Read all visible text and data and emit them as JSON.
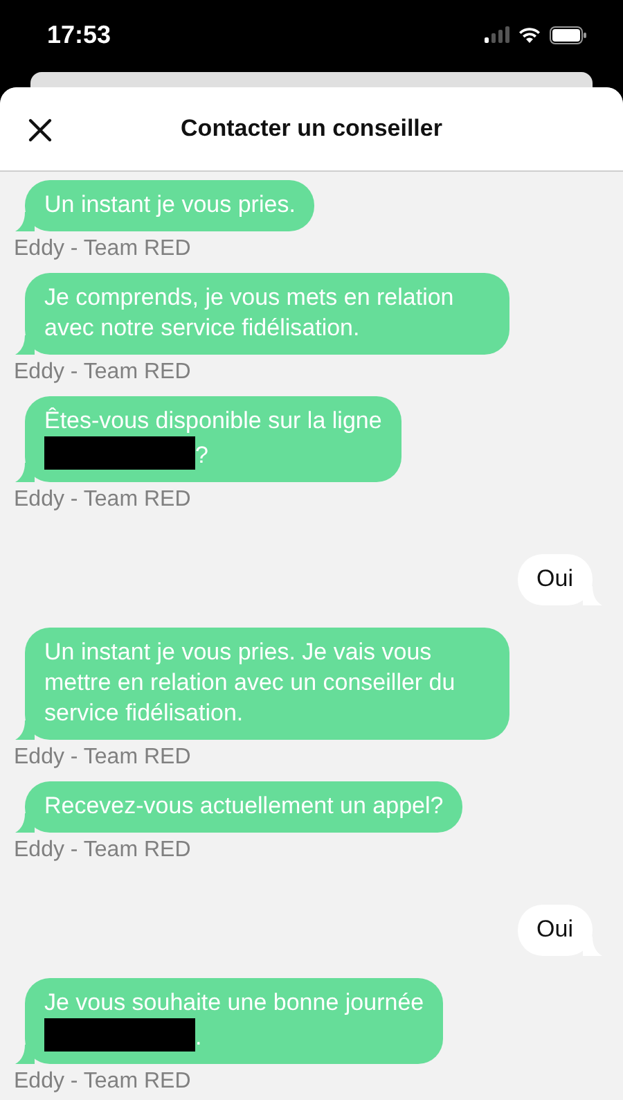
{
  "status_bar": {
    "time": "17:53"
  },
  "header": {
    "title": "Contacter un conseiller"
  },
  "messages": [
    {
      "kind": "agent",
      "text": "Un instant je vous pries.",
      "sender": "Eddy - Team RED"
    },
    {
      "kind": "agent",
      "text": "Je comprends, je vous mets en relation avec notre service fidélisation.",
      "sender": "Eddy - Team RED"
    },
    {
      "kind": "agent",
      "text": "Êtes-vous disponible sur la ligne",
      "redacted": true,
      "after": "?",
      "sender": "Eddy - Team RED"
    },
    {
      "kind": "user",
      "text": "Oui"
    },
    {
      "kind": "agent",
      "text": "Un instant je vous pries. Je vais vous mettre en relation avec un conseiller du service fidélisation.",
      "sender": "Eddy - Team RED"
    },
    {
      "kind": "agent",
      "text": "Recevez-vous actuellement un appel?",
      "sender": "Eddy - Team RED"
    },
    {
      "kind": "user",
      "text": "Oui"
    },
    {
      "kind": "agent",
      "text": "Je vous souhaite une bonne journée",
      "redacted": true,
      "after": ".",
      "sender": "Eddy - Team RED"
    }
  ]
}
